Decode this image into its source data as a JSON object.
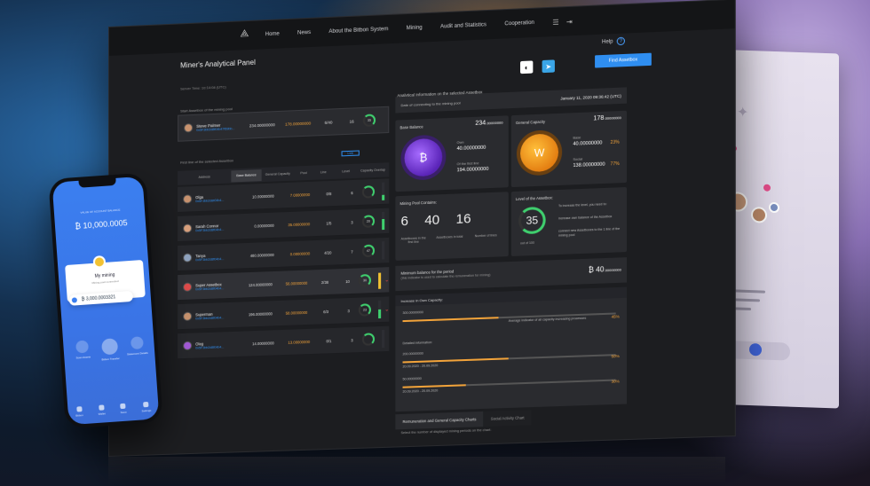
{
  "nav": {
    "items": [
      "Home",
      "News",
      "About the Bitbon System",
      "Mining",
      "Audit and Statistics",
      "Cooperation"
    ],
    "help": "Help"
  },
  "panel": {
    "title": "Miner's Analytical Panel",
    "server_time": "Server Time: 10:14:08 (UTC)",
    "find_button": "Find Assetbox"
  },
  "pool_section": {
    "label": "Start Assetbox of the mining pool",
    "row": {
      "name": "Steve Palmer",
      "address": "0x5F3bb2d8f04b47f69bb...",
      "base": "234.00000000",
      "capacity": "178.00000000",
      "pool": "6/40",
      "line": "16",
      "level": "35"
    }
  },
  "table": {
    "label": "First line of the selected Assetbox",
    "more": "Link",
    "headers": [
      "Address",
      "Base Balance",
      "General Capacity",
      "Pool",
      "Line",
      "Level",
      "Capacity Overlap"
    ],
    "rows": [
      {
        "name": "Olga",
        "address": "0x5F3bb2d8f04b4...",
        "base": "10.00000000",
        "capacity": "7.00000000",
        "pool": "0/8",
        "line": "6",
        "level": "",
        "bar": 0.3,
        "bar_color": "#3fcf6e",
        "highlight": false,
        "chev": ""
      },
      {
        "name": "Sarah Connor",
        "address": "0x5F3bb2d8f04b4...",
        "base": "0.00000000",
        "capacity": "35.00000000",
        "pool": "1/5",
        "line": "3",
        "level": "20",
        "bar": 0.6,
        "bar_color": "#3fcf6e",
        "highlight": false,
        "chev": ""
      },
      {
        "name": "Tanya",
        "address": "0x5F3bb2d8f04b4...",
        "base": "480.00000000",
        "capacity": "0.00000000",
        "pool": "4/20",
        "line": "7",
        "level": "47",
        "bar": 0.0,
        "bar_color": "#3fcf6e",
        "highlight": false,
        "chev": ""
      },
      {
        "name": "Super Assetbox",
        "address": "0x5F3bb2d8f04b4...",
        "base": "124.00000000",
        "capacity": "56.00000000",
        "pool": "2/38",
        "line": "10",
        "level": "30",
        "bar": 0.9,
        "bar_color": "#f2c233",
        "highlight": true,
        "chev": "⌄"
      },
      {
        "name": "Superman",
        "address": "0x5F3bb2d8f04b4...",
        "base": "196.00000000",
        "capacity": "58.00000000",
        "pool": "6/3",
        "line": "3",
        "level": "23",
        "bar": 0.5,
        "bar_color": "#3fcf6e",
        "highlight": false,
        "chev": "⌄"
      },
      {
        "name": "Oleg",
        "address": "0x5F3bb2d8f04b4...",
        "base": "14.00000000",
        "capacity": "13.00000000",
        "pool": "0/1",
        "line": "3",
        "level": "",
        "bar": 0.0,
        "bar_color": "#3fcf6e",
        "highlight": false,
        "chev": ""
      }
    ]
  },
  "analytics": {
    "title": "Analytical Information on the selected Assetbox",
    "date_label": "Date of connecting to the mining pool",
    "date_value": "January 11, 2020 09:36:42 (UTC)",
    "base_balance": {
      "title": "Base Balance",
      "value": "234",
      "decimals": ".00000000",
      "own_label": "Own",
      "own_value": "40.00000000",
      "first_label": "Of the first line",
      "first_value": "194.00000000"
    },
    "general_capacity": {
      "title": "General Capacity",
      "value": "178",
      "decimals": ".00000000",
      "base_label": "Base",
      "base_value": "40.00000000",
      "base_pct": "23%",
      "social_label": "Social",
      "social_value": "138.00000000",
      "social_pct": "77%"
    },
    "pool": {
      "title": "Mining Pool Contains:",
      "values": [
        "6",
        "40",
        "16"
      ],
      "labels": [
        "Assetboxes in the first line",
        "Assetboxes in total",
        "Number of lines"
      ]
    },
    "level": {
      "title": "Level of the Assetbox:",
      "value": "35",
      "of": "out of 100",
      "text1": "To increase the level, you need to:",
      "text2": "increase own balance of the Assetbox",
      "text3": "connect new Assetboxes to the 1 line of the mining pool"
    },
    "min_balance": {
      "title": "Minimum balance for the period",
      "sub": "(this indicator is used to calculate the remuneration for mining)",
      "value": "40",
      "decimals": ".00000000"
    },
    "increase": {
      "title": "Increase in Own Capacity:",
      "v1": "300.00000000",
      "avg": "Average indicator of all capacity increasing processes",
      "avg_pct": "45%",
      "detailed": "Detailed information:",
      "v2": "200.00000000",
      "d2": "20.09.2020 - 20.09.2020",
      "p2": "50%",
      "v3": "50.00000000",
      "d3": "20.09.2020 - 20.09.2020",
      "p3": "30%"
    }
  },
  "tabs": {
    "active": "Remuneration and General Capacity Charts",
    "other": "Social Activity Chart",
    "desc": "Select the number of displayed mining periods on the chart:"
  },
  "phone": {
    "balance_label": "VALUE OF ACCOUNT BALANCE",
    "balance": "₿ 10,000.0005",
    "card_title": "My mining",
    "card_sub": "Mining pool connected",
    "card_value": "₿ 3,000.0003321",
    "actions": [
      "Scan Assets",
      "Bitbon Transfer",
      "Statement Details"
    ],
    "tabs": [
      "Bitbon",
      "Wallet",
      "Store",
      "Settings"
    ]
  },
  "back_card": {
    "value": "0"
  }
}
